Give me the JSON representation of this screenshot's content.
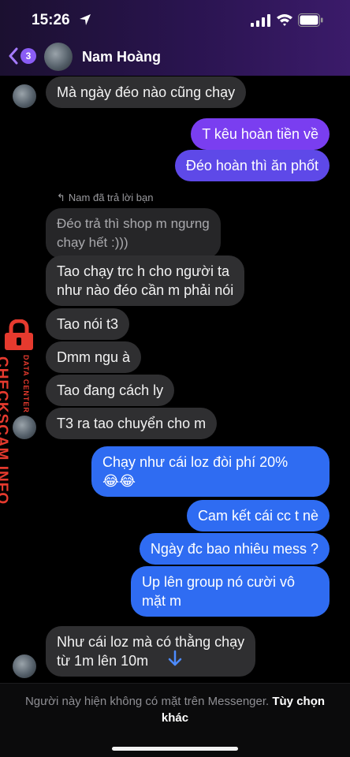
{
  "status_bar": {
    "time": "15:26"
  },
  "header": {
    "back_badge": "3",
    "contact_name": "Nam Hoàng"
  },
  "messages": {
    "m1": "Mà ngày đéo nào cũng chạy",
    "m2": "T kêu hoàn tiền về",
    "m3": "Đéo hoàn thì ăn phốt",
    "reply_label": "Nam đã trả lời bạn",
    "quote": "Đéo trả thì shop m ngưng\nchạy hết :)))",
    "m4": "Tao chạy trc h cho người ta\nnhư nào đéo cần m phải nói",
    "m5": "Tao nói t3",
    "m6": "Dmm ngu à",
    "m7": "Tao đang cách ly",
    "m8": "T3 ra tao chuyển cho m",
    "m9": "Chạy như cái loz đòi phí 20%\n😂😂",
    "m10": "Cam kết cái cc t nè",
    "m11": "Ngày đc bao nhiêu mess ?",
    "m12": "Up lên group nó cười vô\nmặt m",
    "m13": "Như cái loz mà có thằng chạy\ntừ 1m lên 10m"
  },
  "watermark": {
    "main": "CHECKSCAM.INFO",
    "sub": "DATA CENTER"
  },
  "footer": {
    "notice": "Người này hiện không có mặt trên Messenger.",
    "link": "Tùy chọn khác"
  },
  "colors": {
    "incoming": "#2f2f31",
    "outgoing_purple": "#7a3ef0",
    "outgoing_indigo": "#5e49e8",
    "outgoing_blue": "#2f6cf2",
    "watermark": "#e63a2e"
  }
}
